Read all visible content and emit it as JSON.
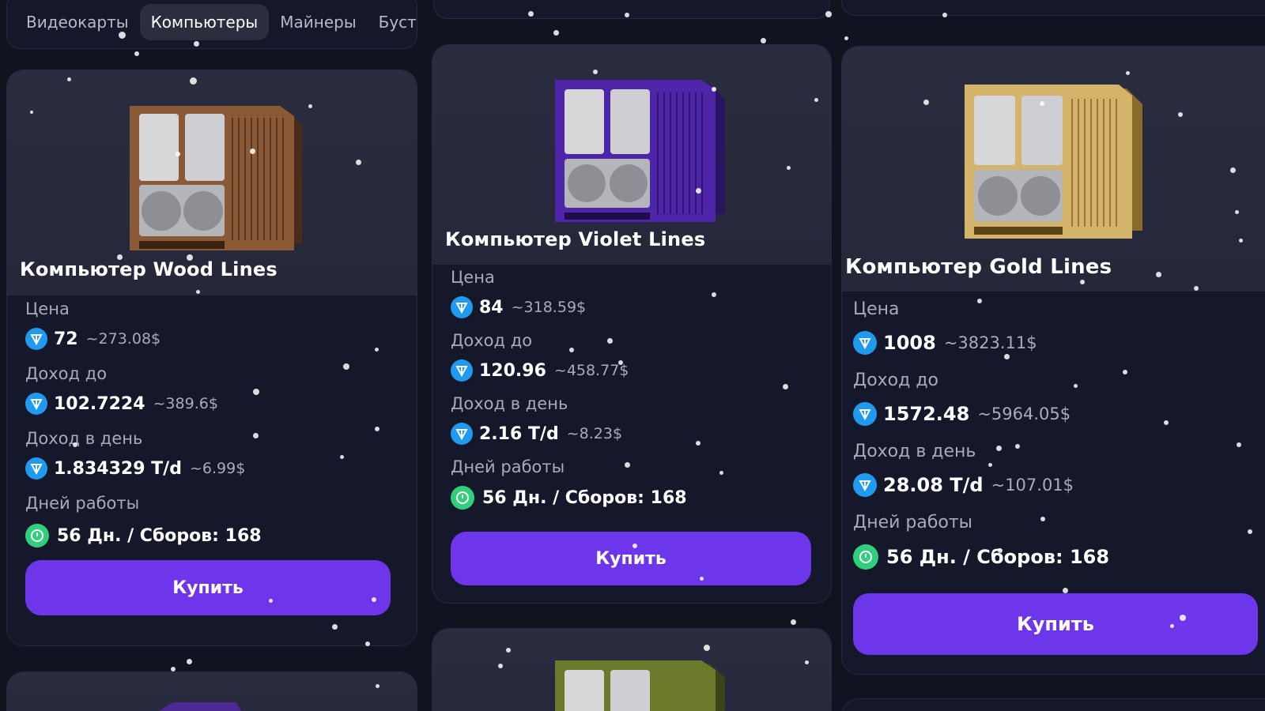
{
  "tabs": [
    "Видеокарты",
    "Компьютеры",
    "Майнеры",
    "Бусте"
  ],
  "active_tab": "Компьютеры",
  "labels": {
    "price": "Цена",
    "income_to": "Доход до",
    "income_day": "Доход в день",
    "days_work": "Дней работы",
    "buy": "Купить"
  },
  "cards": [
    {
      "title": "Компьютер Wood Lines",
      "color": "#7a4a2a",
      "price": "72",
      "price_usd": "~273.08$",
      "income_to": "102.7224",
      "income_to_usd": "~389.6$",
      "income_day": "1.834329 T/d",
      "income_day_usd": "~6.99$",
      "days": "56 Дн. / Сборов: 168"
    },
    {
      "title": "Компьютер Violet Lines",
      "color": "#5a2bb3",
      "price": "84",
      "price_usd": "~318.59$",
      "income_to": "120.96",
      "income_to_usd": "~458.77$",
      "income_day": "2.16 T/d",
      "income_day_usd": "~8.23$",
      "days": "56 Дн. / Сборов: 168"
    },
    {
      "title": "Компьютер Gold Lines",
      "color": "#c9a55a",
      "price": "1008",
      "price_usd": "~3823.11$",
      "income_to": "1572.48",
      "income_to_usd": "~5964.05$",
      "income_day": "28.08 T/d",
      "income_day_usd": "~107.01$",
      "days": "56 Дн. / Сборов: 168"
    }
  ],
  "partial_cards": [
    {
      "color": "#5a2bb3"
    },
    {
      "color": "#6b7a2a"
    }
  ],
  "colors": {
    "accent": "#6d36ea",
    "ton": "#1e9bf0",
    "green": "#2fcf7b",
    "background": "#111320"
  },
  "icons": {
    "currency": "ton-coin-icon",
    "days": "green-clock-icon"
  }
}
